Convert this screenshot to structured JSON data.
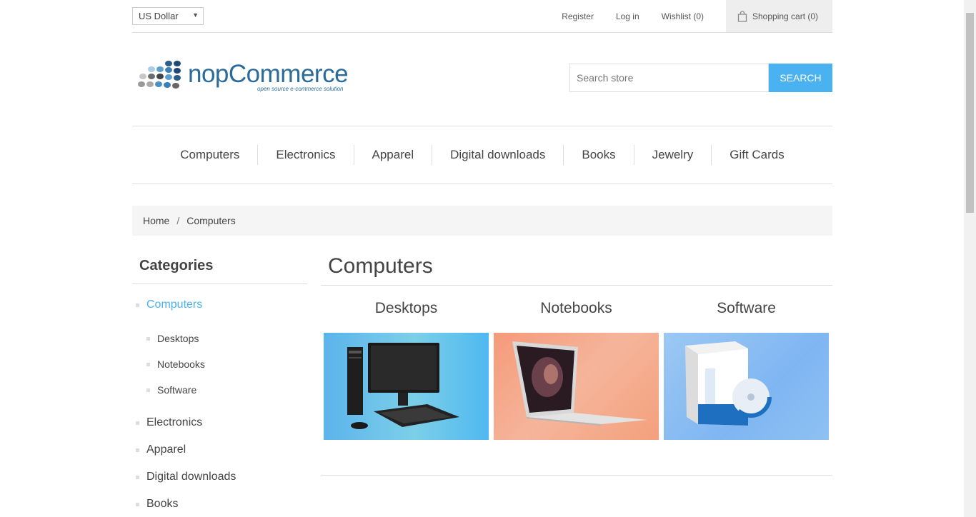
{
  "header": {
    "currency": "US Dollar",
    "links": {
      "register": "Register",
      "login": "Log in",
      "wishlist": "Wishlist (0)",
      "cart": "Shopping cart (0)"
    }
  },
  "logo": {
    "name": "nopCommerce",
    "tagline": "open source e-commerce solution"
  },
  "search": {
    "placeholder": "Search store",
    "button": "Search"
  },
  "menu": [
    "Computers",
    "Electronics",
    "Apparel",
    "Digital downloads",
    "Books",
    "Jewelry",
    "Gift Cards"
  ],
  "breadcrumb": {
    "home": "Home",
    "separator": "/",
    "current": "Computers"
  },
  "sidebar": {
    "title": "Categories",
    "active": "Computers",
    "subcategories": [
      "Desktops",
      "Notebooks",
      "Software"
    ],
    "others": [
      "Electronics",
      "Apparel",
      "Digital downloads",
      "Books"
    ]
  },
  "main": {
    "title": "Computers",
    "subcategories": [
      {
        "name": "Desktops",
        "image": "desktop-computer-image"
      },
      {
        "name": "Notebooks",
        "image": "laptop-image"
      },
      {
        "name": "Software",
        "image": "software-package-image"
      }
    ]
  },
  "colors": {
    "accent": "#4ab2f1",
    "logo": "#2a6b9c"
  }
}
